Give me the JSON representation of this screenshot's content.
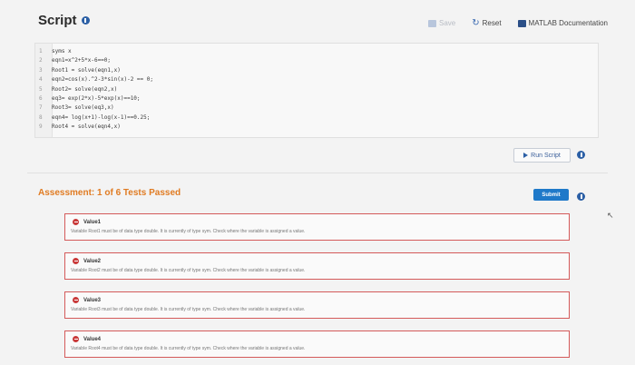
{
  "header": {
    "title": "Script",
    "save_label": "Save",
    "reset_label": "Reset",
    "doc_label": "MATLAB Documentation"
  },
  "code": {
    "lines": [
      {
        "num": "1",
        "text": "syms x"
      },
      {
        "num": "2",
        "text": "eqn1=x^2+5*x-6==0;"
      },
      {
        "num": "3",
        "text": "Root1 = solve(eqn1,x)"
      },
      {
        "num": "4",
        "text": "eqn2=cos(x).^2-3*sin(x)-2 == 0;"
      },
      {
        "num": "5",
        "text": "Root2= solve(eqn2,x)"
      },
      {
        "num": "6",
        "text": "eq3= exp(2*x)-5*exp(x)==10;"
      },
      {
        "num": "7",
        "text": "Root3= solve(eq3,x)"
      },
      {
        "num": "8",
        "text": "eqn4= log(x+1)-log(x-1)==0.25;"
      },
      {
        "num": "9",
        "text": "Root4 = solve(eqn4,x)"
      }
    ]
  },
  "run_button": {
    "label": "Run Script"
  },
  "assessment": {
    "title": "Assessment: 1 of 6 Tests Passed",
    "submit_label": "Submit",
    "tests": [
      {
        "name": "Value1",
        "message": "Variable Root1 must be of data type double. It is currently of type sym. Check where the variable is assigned a value."
      },
      {
        "name": "Value2",
        "message": "Variable Root2 must be of data type double. It is currently of type sym. Check where the variable is assigned a value."
      },
      {
        "name": "Value3",
        "message": "Variable Root3 must be of data type double. It is currently of type sym. Check where the variable is assigned a value."
      },
      {
        "name": "Value4",
        "message": "Variable Root4 must be of data type double. It is currently of type sym. Check where the variable is assigned a value."
      }
    ]
  },
  "colors": {
    "accent_orange": "#e07b22",
    "fail_red": "#c93a3a",
    "submit_blue": "#1f79c9"
  }
}
